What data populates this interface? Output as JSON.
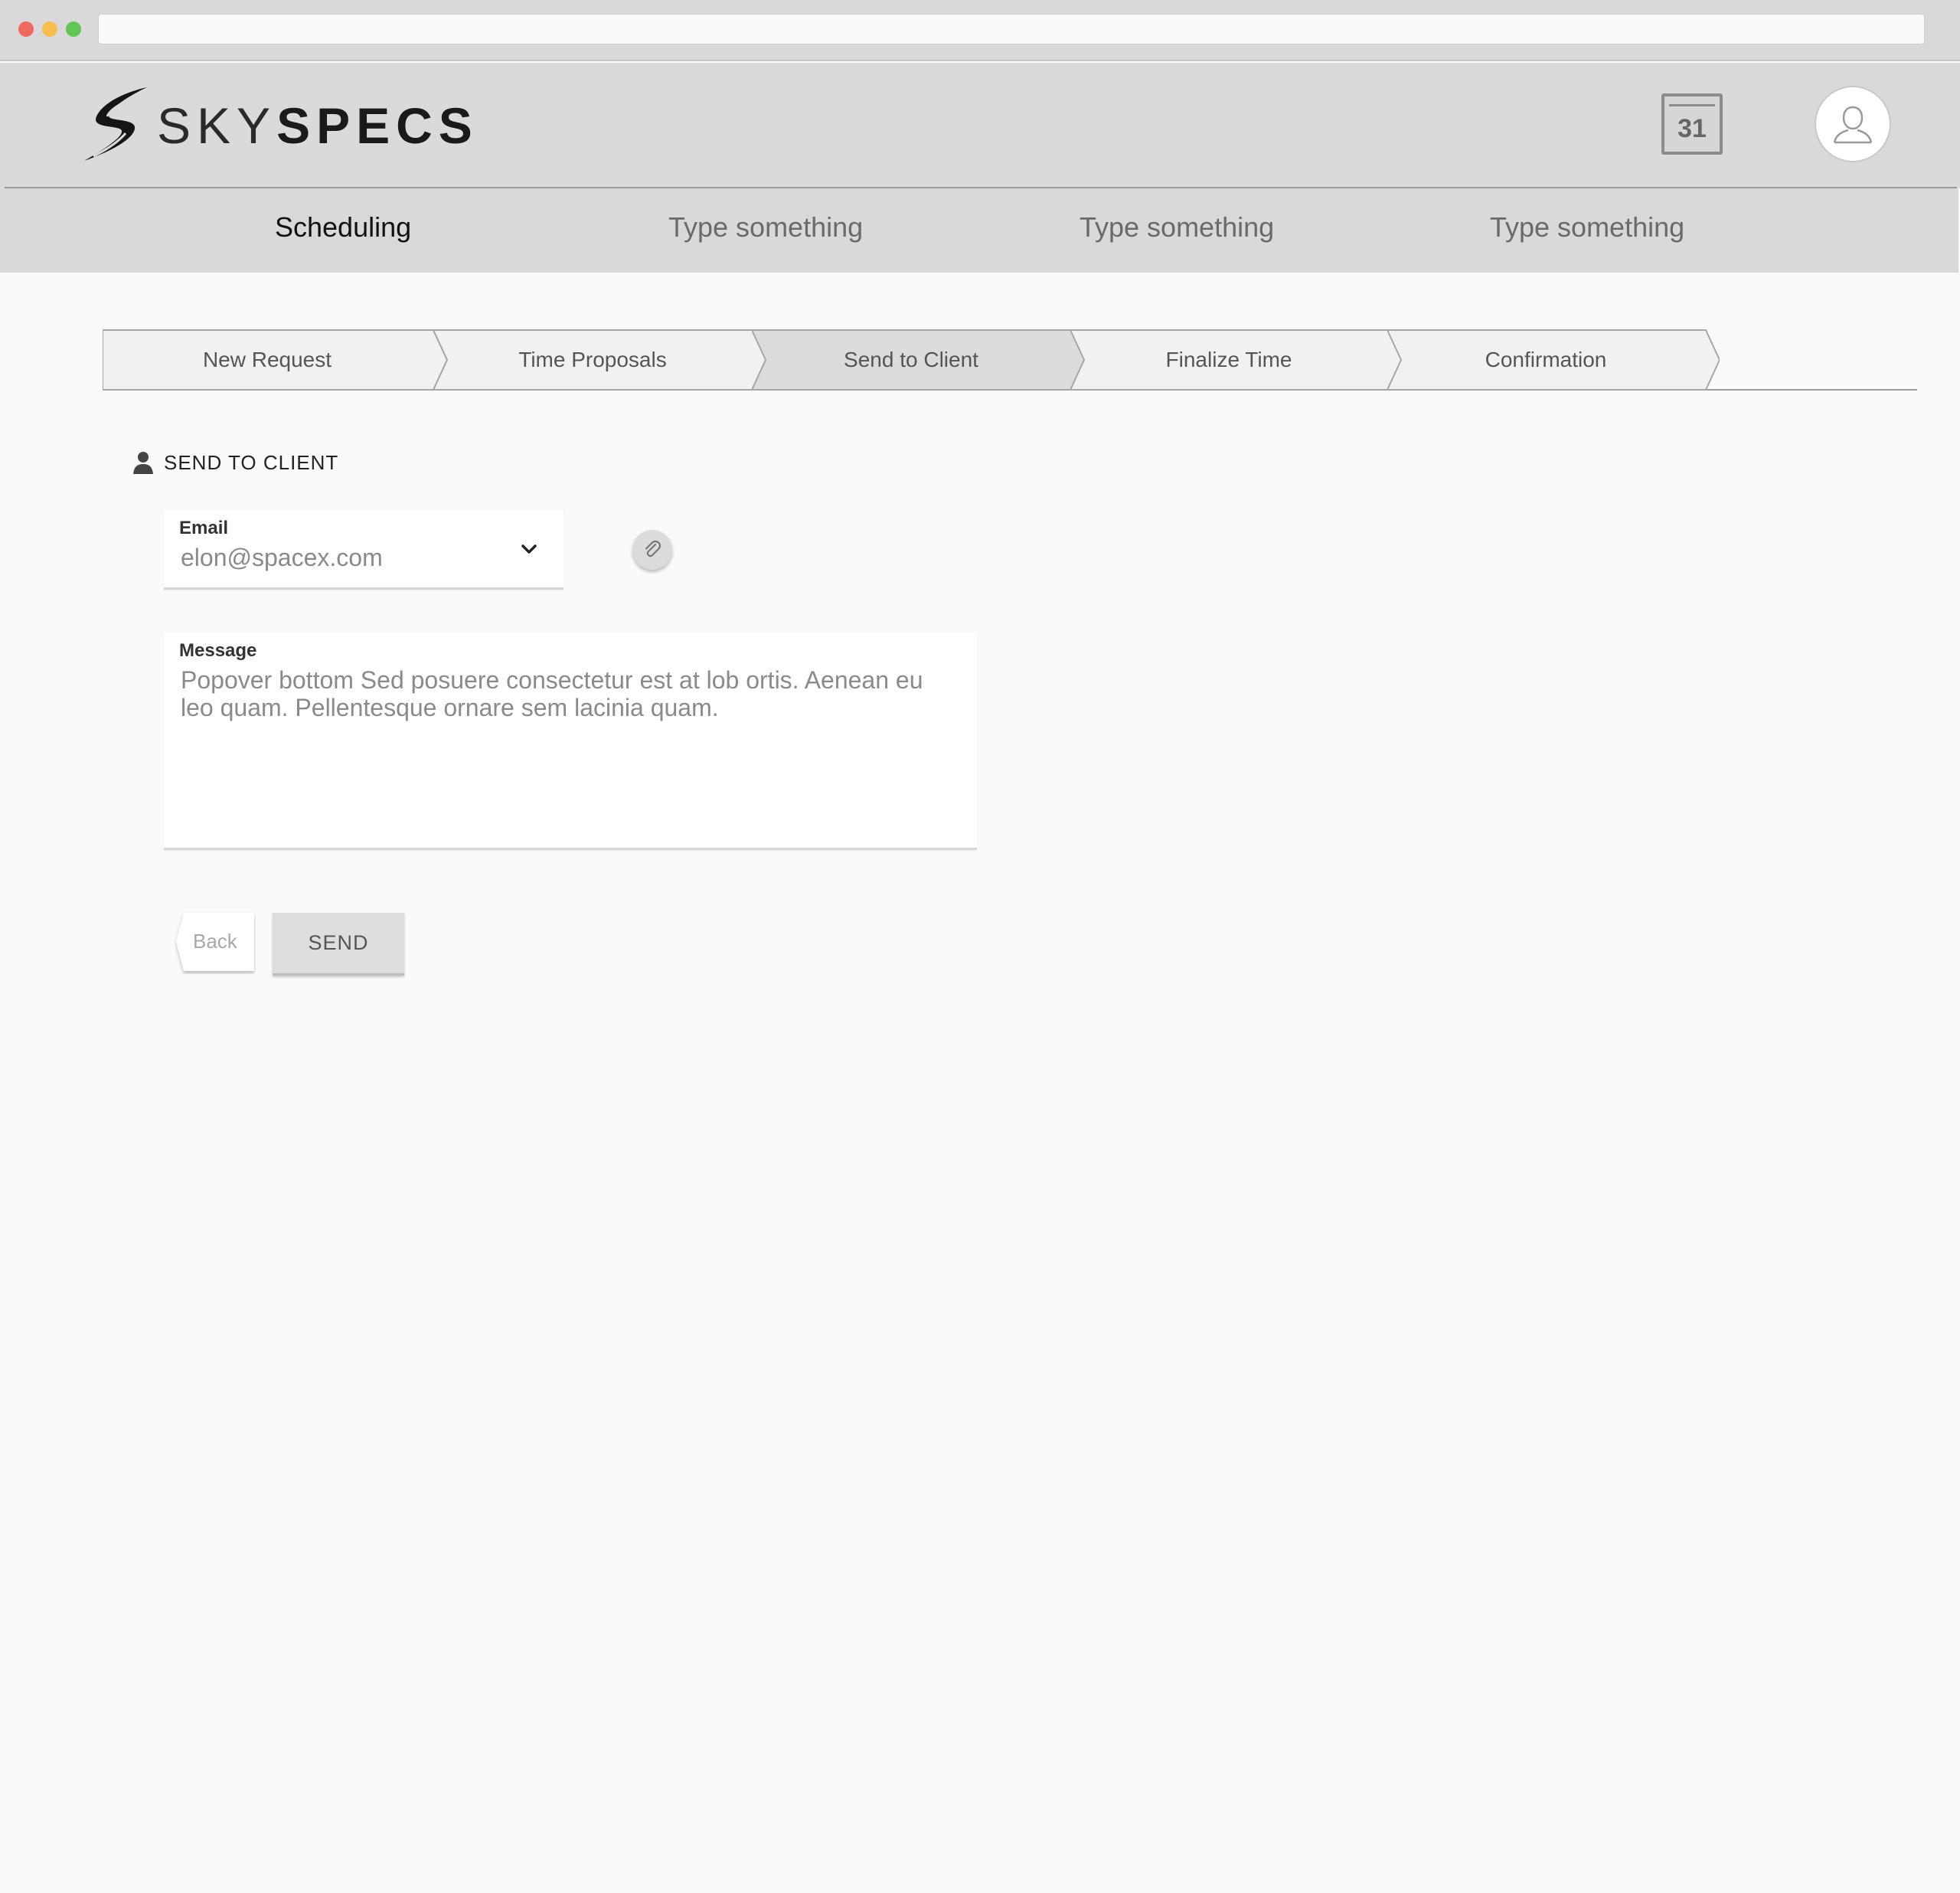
{
  "brand": {
    "name_light": "SKY",
    "name_bold": "SPECS"
  },
  "header": {
    "calendar_day": "31"
  },
  "nav": {
    "items": [
      {
        "label": "Scheduling",
        "active": true
      },
      {
        "label": "Type something",
        "active": false
      },
      {
        "label": "Type something",
        "active": false
      },
      {
        "label": "Type something",
        "active": false
      }
    ]
  },
  "stepper": {
    "steps": [
      {
        "label": "New Request",
        "active": false
      },
      {
        "label": "Time Proposals",
        "active": false
      },
      {
        "label": "Send to Client",
        "active": true
      },
      {
        "label": "Finalize Time",
        "active": false
      },
      {
        "label": "Confirmation",
        "active": false
      }
    ]
  },
  "form": {
    "section_title": "SEND TO CLIENT",
    "email": {
      "label": "Email",
      "value": "elon@spacex.com"
    },
    "message": {
      "label": "Message",
      "value": "Popover bottom Sed posuere consectetur est at lob ortis. Aenean eu leo quam. Pellentesque ornare sem lacinia quam."
    },
    "back_label": "Back",
    "send_label": "SEND"
  },
  "icons": {
    "logo": "skyspecs-logo-icon",
    "calendar": "calendar-icon",
    "avatar": "user-avatar-icon",
    "section": "person-icon",
    "chevron": "chevron-down-icon",
    "attach": "paperclip-icon"
  }
}
